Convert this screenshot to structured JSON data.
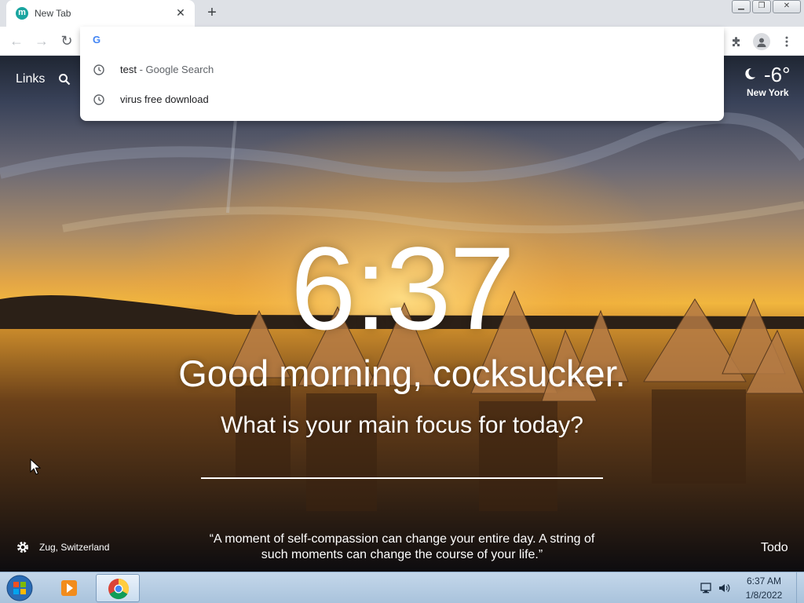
{
  "browser": {
    "tab_title": "New Tab",
    "tab_favicon_letter": "m",
    "omnibox": {
      "value": "",
      "suggestions": [
        {
          "text": "test",
          "sub": " - Google Search"
        },
        {
          "text": "virus free download",
          "sub": ""
        }
      ]
    }
  },
  "dashboard": {
    "links_label": "Links",
    "weather": {
      "temp": "-6°",
      "city": "New York"
    },
    "time": "6:37",
    "greeting": "Good morning, cocksucker.",
    "focus_question": "What is your main focus for today?",
    "focus_value": "",
    "photo_location": "Zug, Switzerland",
    "quote": "“A moment of self-compassion can change your entire day. A string of such moments can change the course of your life.”",
    "todo_label": "Todo"
  },
  "taskbar": {
    "time": "6:37 AM",
    "date": "1/8/2022"
  },
  "colors": {
    "tab_bg": "#ffffff",
    "tabstrip_bg": "#dee1e6",
    "favicon": "#1aa5a0",
    "taskbar": "#b8cde3"
  }
}
